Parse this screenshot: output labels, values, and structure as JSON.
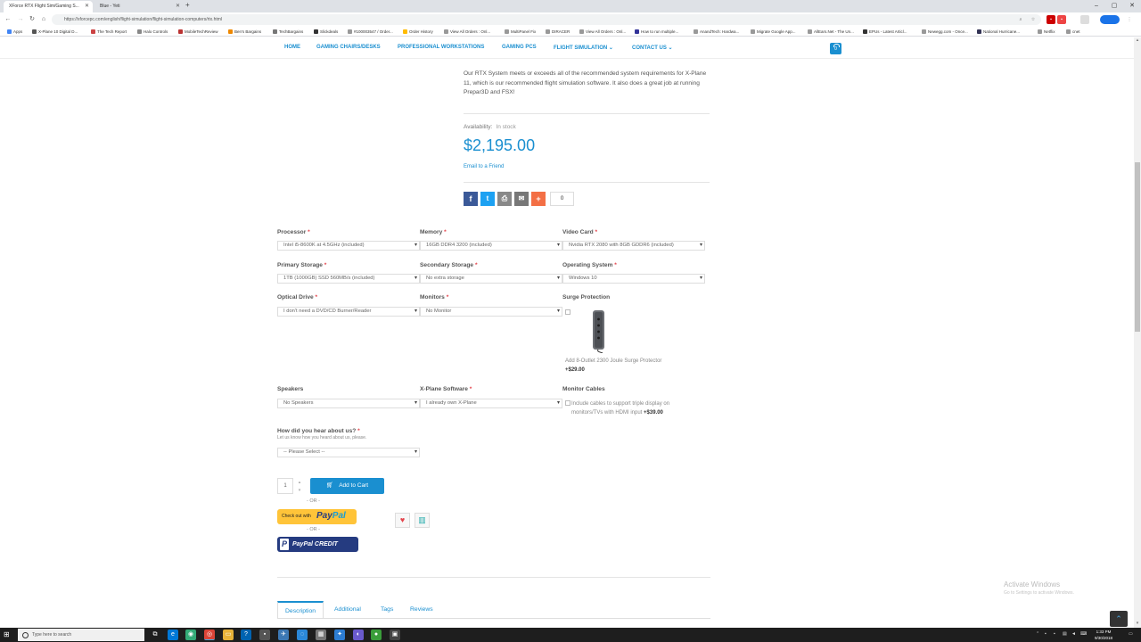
{
  "browser": {
    "tabs": [
      {
        "title": "XForce RTX Flight Sim/Gaming S..."
      },
      {
        "title": "Blue - Yeti"
      }
    ],
    "url": "https://xforcepc.com/english/flight-simulation/flight-simulation-computers/rtx.html",
    "bookmarks": [
      "Apps",
      "X-Plane 10 Digital D...",
      "The Tech Report",
      "Halo Controls",
      "MobileTechReview",
      "Ben's Bargains",
      "TechBargains",
      "Slickdeals",
      "#100003547 / Order...",
      "Order History",
      "View All Orders : Onl...",
      "MultiPanel Fix",
      "DIRACER",
      "View All Orders : Onl...",
      "How to run multiple...",
      "AnandTech: Hardwa...",
      "Migrate Google App...",
      "AllEars.Net - The Un...",
      "EPUs - Latest Articl...",
      "Newegg.com - Once...",
      "National Hurricane...",
      "Netflix",
      "cnet"
    ]
  },
  "nav": {
    "items": [
      "HOME",
      "GAMING CHAIRS/DESKS",
      "PROFESSIONAL WORKSTATIONS",
      "GAMING PCS",
      "FLIGHT SIMULATION ⌄",
      "CONTACT US ⌄"
    ],
    "cart_count": "0"
  },
  "product": {
    "description": "Our RTX System meets or exceeds all of the recommended system requirements for X-Plane 11, which is our recommended flight simulation software. It also does a great job at running Prepar3D and FSX!",
    "availability_label": "Availability:",
    "availability_value": "In stock",
    "price": "$2,195.00",
    "email_friend": "Email to a Friend",
    "share_count": "0"
  },
  "attributes": {
    "processor": {
      "label": "Processor",
      "value": "Intel i5-8600K at 4.5GHz (included)"
    },
    "memory": {
      "label": "Memory",
      "value": "16GB DDR4 3200 (included)"
    },
    "video_card": {
      "label": "Video Card",
      "value": "Nvidia RTX 2080 with 8GB GDDR6 (included)"
    },
    "primary_storage": {
      "label": "Primary Storage",
      "value": "1TB (1000GB) SSD 560MB/s (included)"
    },
    "secondary_storage": {
      "label": "Secondary Storage",
      "value": "No extra storage"
    },
    "operating_system": {
      "label": "Operating System",
      "value": "Windows 10"
    },
    "optical_drive": {
      "label": "Optical Drive",
      "value": "I don't need a DVD/CD Burner/Reader"
    },
    "monitors": {
      "label": "Monitors",
      "value": "No Monitor"
    },
    "surge": {
      "label": "Surge Protection",
      "option_text": "Add 8-Outlet 2300 Joule Surge Protector",
      "price": "+$29.00"
    },
    "speakers": {
      "label": "Speakers",
      "value": "No Speakers"
    },
    "xplane": {
      "label": "X-Plane Software",
      "value": "I already own X-Plane"
    },
    "monitor_cables": {
      "label": "Monitor Cables",
      "option_text": "Include cables to support triple display on monitors/TVs with HDMI input",
      "price": "+$39.00"
    },
    "hear_about": {
      "label": "How did you hear about us?",
      "hint": "Let us know how you heard about us, please.",
      "value": "-- Please Select --"
    }
  },
  "purchase": {
    "qty": "1",
    "add_to_cart": "Add to Cart",
    "or": "- OR -",
    "paypal_prefix": "Check out with",
    "paypal_pay": "Pay",
    "paypal_pal": "Pal",
    "paypal_credit": "PayPal CREDIT"
  },
  "tabs": [
    "Description",
    "Additional",
    "Tags",
    "Reviews"
  ],
  "watermark": {
    "line1": "Activate Windows",
    "line2": "Go to Settings to activate Windows."
  },
  "taskbar": {
    "search_placeholder": "Type here to search",
    "time": "1:33 PM",
    "date": "9/30/2018"
  },
  "colors": {
    "accent": "#1a8fd0",
    "required": "#e4434b",
    "paypal_yellow": "#ffc439",
    "paypal_blue": "#253b80"
  }
}
